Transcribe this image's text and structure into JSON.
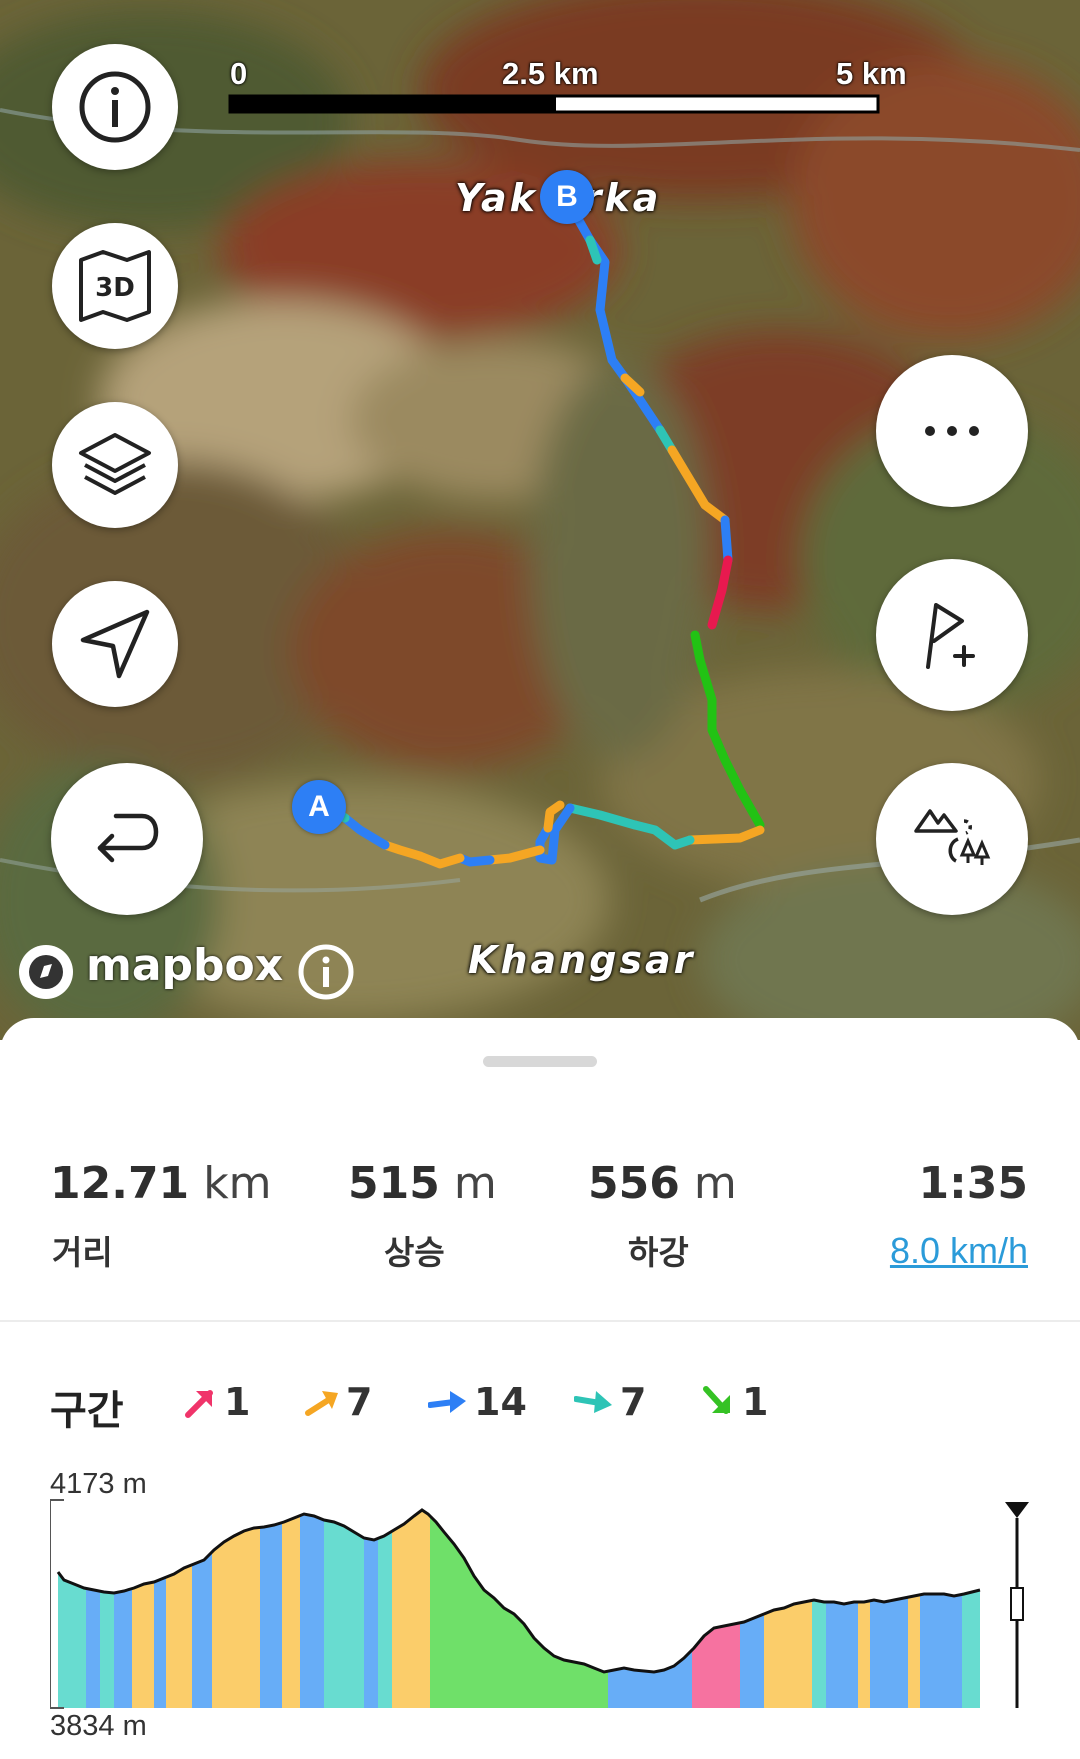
{
  "map": {
    "scale": {
      "left": "0",
      "mid": "2.5 km",
      "right": "5 km"
    },
    "places": {
      "top": "Yak  arka",
      "bottom": "Khangsar"
    },
    "markers": {
      "start": "A",
      "end": "B"
    },
    "attribution": "mapbox",
    "buttons_left": [
      "info-icon",
      "3d-map-icon",
      "layers-icon",
      "location-arrow-icon",
      "return-route-icon"
    ],
    "buttons_right": [
      "more-icon",
      "add-waypoint-icon",
      "poi-icon"
    ],
    "button_3d_label": "3D"
  },
  "stats": {
    "distance": {
      "value": "12.71",
      "unit": "km",
      "label": "거리"
    },
    "ascent": {
      "value": "515",
      "unit": "m",
      "label": "상승"
    },
    "descent": {
      "value": "556",
      "unit": "m",
      "label": "하강"
    },
    "duration": {
      "value": "1:35",
      "speed": "8.0 km/h"
    }
  },
  "segments": {
    "title": "구간",
    "items": [
      {
        "count": "1",
        "color": "#f0346a",
        "icon": "steep-up-arrow-icon"
      },
      {
        "count": "7",
        "color": "#f5a623",
        "icon": "up-arrow-icon"
      },
      {
        "count": "14",
        "color": "#2d7ff5",
        "icon": "flat-arrow-icon"
      },
      {
        "count": "7",
        "color": "#2ec4b6",
        "icon": "slight-down-arrow-icon"
      },
      {
        "count": "1",
        "color": "#35c224",
        "icon": "steep-down-arrow-icon"
      }
    ]
  },
  "elevation": {
    "max_label": "4173 m",
    "min_label": "3834 m"
  },
  "colors": {
    "orange": "#f5a623",
    "blue": "#2d7ff5",
    "teal": "#2ec4b6",
    "red": "#f0346a",
    "green": "#35c224",
    "link": "#2b9bd9"
  }
}
